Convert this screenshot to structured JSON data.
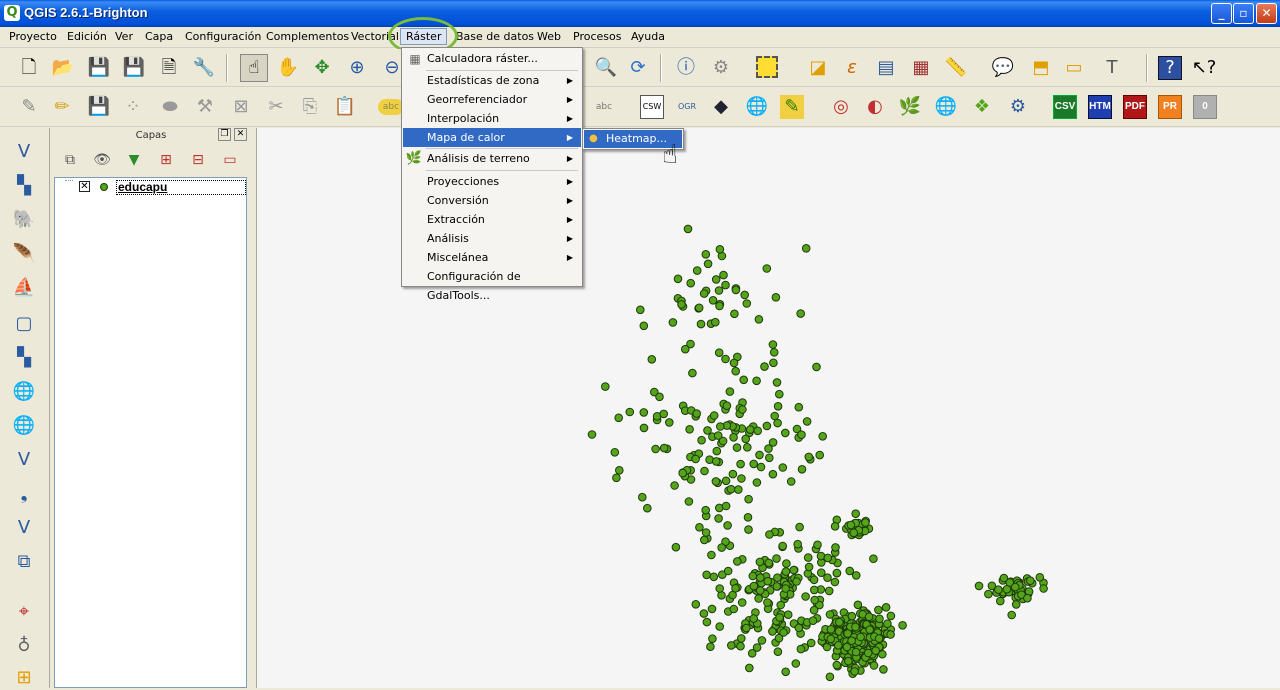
{
  "window": {
    "title": "QGIS 2.6.1-Brighton",
    "app_icon": "Q"
  },
  "menubar": {
    "items": [
      "Proyecto",
      "Edición",
      "Ver",
      "Capa",
      "Configuración",
      "Complementos",
      "Vectorial",
      "Ráster",
      "Base de datos",
      "Web",
      "Procesos",
      "Ayuda"
    ]
  },
  "raster_menu": {
    "items": [
      "Calculadora ráster...",
      "Estadísticas de zona",
      "Georreferenciador",
      "Interpolación",
      "Mapa de calor",
      "Análisis de terreno",
      "Proyecciones",
      "Conversión",
      "Extracción",
      "Análisis",
      "Miscelánea",
      "Configuración de GdalTools..."
    ],
    "highlighted": "Mapa de calor"
  },
  "heatmap_submenu": {
    "item": "Heatmap..."
  },
  "toolbar_badges": {
    "csv": "CSV",
    "htm": "HTM",
    "pdf": "PDF",
    "pr": "PR",
    "zero": "0"
  },
  "layers_panel": {
    "title": "Capas",
    "layers": [
      {
        "name": "educapu",
        "visible": true
      }
    ]
  },
  "colors": {
    "point_fill": "#55A51C",
    "point_stroke": "#1E3A08",
    "menu_highlight": "#316AC5",
    "accent_ring": "#7BBB3A"
  },
  "map": {
    "point_count_approx": 700
  }
}
